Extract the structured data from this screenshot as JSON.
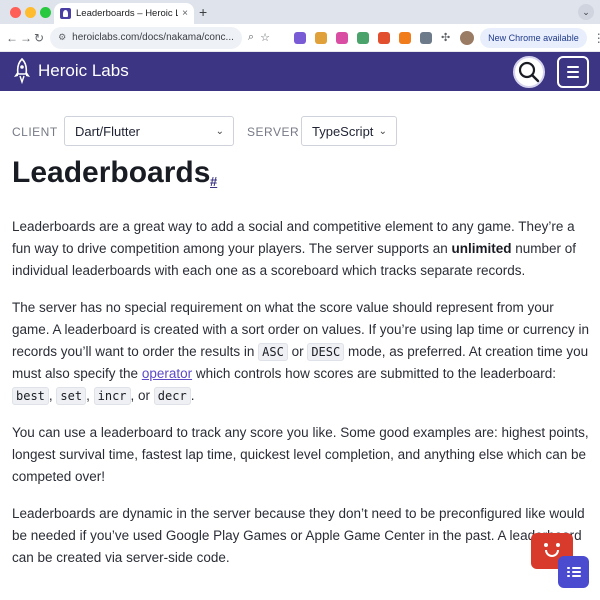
{
  "browser": {
    "tab_title": "Leaderboards – Heroic Labs D",
    "tab_close": "×",
    "new_tab": "+",
    "tab_menu": "⌄",
    "url": "heroiclabs.com/docs/nakama/conc...",
    "new_chrome": "New Chrome available",
    "kebab": "⋮",
    "back": "←",
    "forward": "→",
    "reload": "↻",
    "ext_colors": [
      "#7a5bd6",
      "#e0a13a",
      "#d94ea3",
      "#4aa36b",
      "#e24f2f",
      "#f07c1b",
      "#6c7a89"
    ]
  },
  "site": {
    "brand": "Heroic Labs",
    "header_color": "#3b3583"
  },
  "selectors": {
    "client_label": "CLIENT",
    "client_value": "Dart/Flutter",
    "server_label": "SERVER",
    "server_value": "TypeScript"
  },
  "page": {
    "title": "Leaderboards",
    "anchor": "#",
    "p1": {
      "a": "Leaderboards are a great way to add a social and competitive element to any game. They’re a fun way to drive competition among your players. The server supports an ",
      "bold": "unlimited",
      "b": " number of individual leaderboards with each one as a scoreboard which tracks separate records."
    },
    "p2": {
      "a": "The server has no special requirement on what the score value should represent from your game. A leaderboard is created with a sort order on values. If you’re using lap time or currency in records you’ll want to order the results in ",
      "code1": "ASC",
      "b": " or ",
      "code2": "DESC",
      "c": " mode, as preferred. At creation time you must also specify the ",
      "link": "operator",
      "d": " which controls how scores are submitted to the leaderboard: ",
      "op1": "best",
      "sep1": ", ",
      "op2": "set",
      "sep2": ", ",
      "op3": "incr",
      "sep3": ", or ",
      "op4": "decr",
      "end": "."
    },
    "p3": "You can use a leaderboard to track any score you like. Some good examples are: highest points, longest survival time, fastest lap time, quickest level completion, and anything else which can be competed over!",
    "p4": "Leaderboards are dynamic in the server because they don’t need to be preconfigured like would be needed if you’ve used Google Play Games or Apple Game Center in the past. A leaderboard can be created via server-side code."
  }
}
